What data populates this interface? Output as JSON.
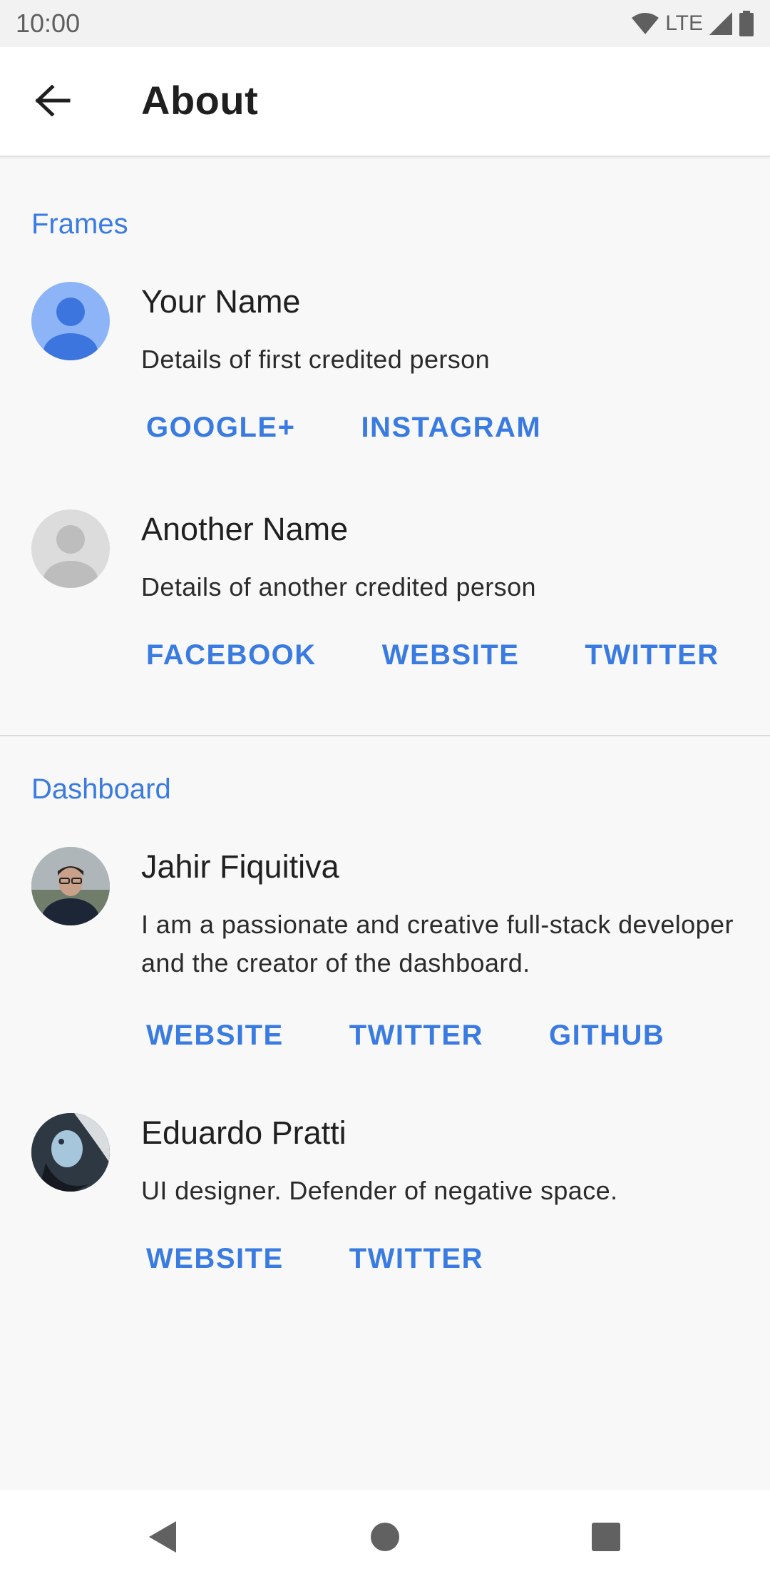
{
  "status_bar": {
    "time": "10:00",
    "network": "LTE",
    "icons": [
      "wifi-icon",
      "signal-icon",
      "battery-icon"
    ]
  },
  "app_bar": {
    "title": "About",
    "back_icon": "arrow-back-icon"
  },
  "accent_color": "#3a7be2",
  "sections": [
    {
      "title": "Frames",
      "people": [
        {
          "name": "Your Name",
          "description": "Details of first credited person",
          "links": [
            "GOOGLE+",
            "INSTAGRAM"
          ]
        },
        {
          "name": "Another Name",
          "description": "Details of another credited person",
          "links": [
            "FACEBOOK",
            "WEBSITE",
            "TWITTER"
          ]
        }
      ]
    },
    {
      "title": "Dashboard",
      "people": [
        {
          "name": "Jahir Fiquitiva",
          "description": "I am a passionate and creative full-stack developer and the creator of the dashboard.",
          "links": [
            "WEBSITE",
            "TWITTER",
            "GITHUB"
          ]
        },
        {
          "name": "Eduardo Pratti",
          "description": "UI designer. Defender of negative space.",
          "links": [
            "WEBSITE",
            "TWITTER"
          ]
        }
      ]
    }
  ],
  "nav_bar": {
    "icons": [
      "back-triangle-icon",
      "home-circle-icon",
      "recents-square-icon"
    ]
  }
}
